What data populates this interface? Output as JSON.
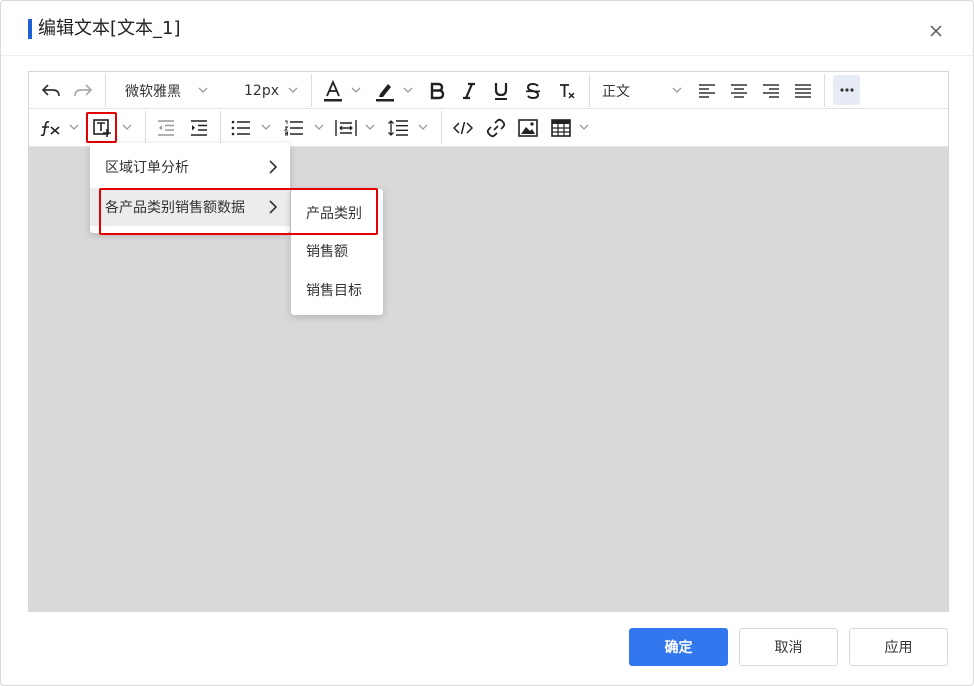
{
  "dialog": {
    "title": "编辑文本[文本_1]"
  },
  "toolbar": {
    "font_family": "微软雅黑",
    "font_size": "12px",
    "paragraph_style": "正文",
    "icons": [
      "undo-icon",
      "redo-icon",
      "font-color-icon",
      "highlight-icon",
      "bold-icon",
      "italic-icon",
      "underline-icon",
      "strikethrough-icon",
      "clear-format-icon",
      "align-left-icon",
      "align-center-icon",
      "align-right-icon",
      "align-justify-icon",
      "more-icon",
      "formula-icon",
      "insert-field-icon",
      "outdent-icon",
      "indent-icon",
      "bullet-list-icon",
      "numbered-list-icon",
      "letter-spacing-icon",
      "line-height-icon",
      "code-icon",
      "link-icon",
      "image-icon",
      "table-icon"
    ]
  },
  "field_menu": {
    "items": [
      {
        "label": "区域订单分析"
      },
      {
        "label": "各产品类别销售额数据"
      }
    ]
  },
  "field_submenu": {
    "items": [
      {
        "label": "产品类别"
      },
      {
        "label": "销售额"
      },
      {
        "label": "销售目标"
      }
    ]
  },
  "footer": {
    "confirm": "确定",
    "cancel": "取消",
    "apply": "应用"
  },
  "colors": {
    "primary": "#3377ee",
    "title_accent": "#1f5fd6",
    "highlight_outline": "#e30000",
    "canvas_bg": "#d9d9d9"
  }
}
